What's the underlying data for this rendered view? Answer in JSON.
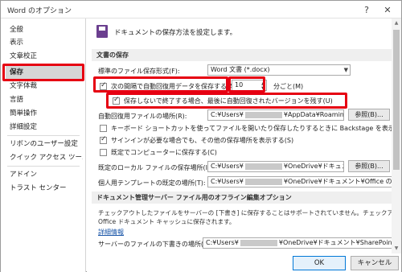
{
  "window": {
    "title": "Word のオプション",
    "help_icon": "?",
    "close_icon": "✕"
  },
  "sidebar": {
    "items": [
      {
        "label": "全般"
      },
      {
        "label": "表示"
      },
      {
        "label": "文章校正"
      },
      {
        "label": "保存",
        "selected": true
      },
      {
        "label": "文字体裁"
      },
      {
        "label": "言語"
      },
      {
        "label": "簡単操作"
      },
      {
        "label": "詳細設定"
      },
      {
        "label": "リボンのユーザー設定"
      },
      {
        "label": "クイック アクセス ツール バー"
      },
      {
        "label": "アドイン"
      },
      {
        "label": "トラスト センター"
      }
    ]
  },
  "main": {
    "header_text": "ドキュメントの保存方法を設定します。",
    "save_section": {
      "title": "文書の保存",
      "format_label": "標準のファイル保存形式(F):",
      "format_value": "Word 文書 (*.docx)",
      "autorecover_label": "次の間隔で自動回復用データを保存する(A):",
      "autorecover_minutes": "10",
      "autorecover_unit": "分ごと(M)",
      "keep_last_label": "保存しないで終了する場合、最後に自動回復されたバージョンを残す(U)",
      "autorecover_location_label": "自動回復用ファイルの場所(R):",
      "autorecover_location_value_a": "C:¥Users¥",
      "autorecover_location_value_b": "¥AppData¥Roaming¥Microso",
      "browse_r": "参照(B)...",
      "backstage_label": "キーボード ショートカットを使ってファイルを開いたり保存したりするときに Backstage を表示しない(S)",
      "signin_label": "サインインが必要な場合でも、その他の保存場所を表示する(S)",
      "default_computer_label": "既定でコンピューターに保存する(C)",
      "local_location_label": "既定のローカル ファイルの保存場所(I):",
      "local_location_value_a": "C:¥Users¥",
      "local_location_value_b": "¥OneDrive¥ドキュメント¥",
      "browse_i": "参照(B)...",
      "template_location_label": "個人用テンプレートの既定の場所(T):",
      "template_location_value_a": "C:¥Users¥",
      "template_location_value_b": "¥OneDrive¥ドキュメント¥Office のカスタム テンプレ"
    },
    "offline_section": {
      "title": "ドキュメント管理サーバー ファイル用のオフライン編集オプション",
      "desc_line1": "チェックアウトしたファイルをサーバーの [下書き] に保存することはサポートされていません。チェックアウトされたファイルは",
      "desc_line2": "Office ドキュメント キャッシュに保存されます。",
      "details_link": "詳細情報",
      "drafts_label": "サーバーのファイルの下書きの場所(V):",
      "drafts_value_a": "C:¥Users¥",
      "drafts_value_b": "¥OneDrive¥ドキュメント¥SharePoint 下書き¥"
    }
  },
  "footer": {
    "ok_label": "OK",
    "cancel_label": "キャンセル"
  },
  "colors": {
    "highlight_red": "#e60012",
    "selected_nav_bg": "#d6d6d6",
    "save_icon": "#6b3f8f"
  },
  "icons": {
    "header": "save-icon",
    "dropdown": "chevron-down-icon",
    "spin": "spin-arrows-icon"
  }
}
